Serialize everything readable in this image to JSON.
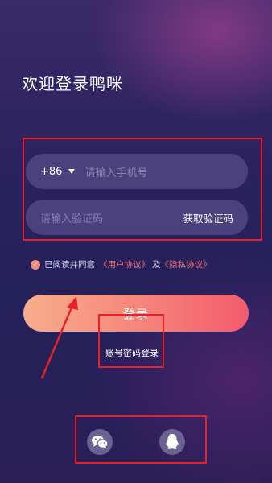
{
  "header": {
    "welcome": "欢迎登录鸭咪"
  },
  "phone": {
    "country_code": "+86",
    "placeholder": "请输入手机号"
  },
  "code": {
    "placeholder": "请输入验证码",
    "get_code": "获取验证码"
  },
  "agreement": {
    "prefix": "已阅读并同意",
    "user_agreement": "《用户协议》",
    "and": "及",
    "privacy": "《隐私协议》"
  },
  "login": {
    "label": "登录"
  },
  "password_login": {
    "label": "账号密码登录"
  },
  "social": {
    "icons": [
      "wechat-icon",
      "qq-icon"
    ]
  },
  "colors": {
    "accent_start": "#f7ae8c",
    "accent_end": "#f35b6e",
    "annotation": "#e8202a"
  }
}
